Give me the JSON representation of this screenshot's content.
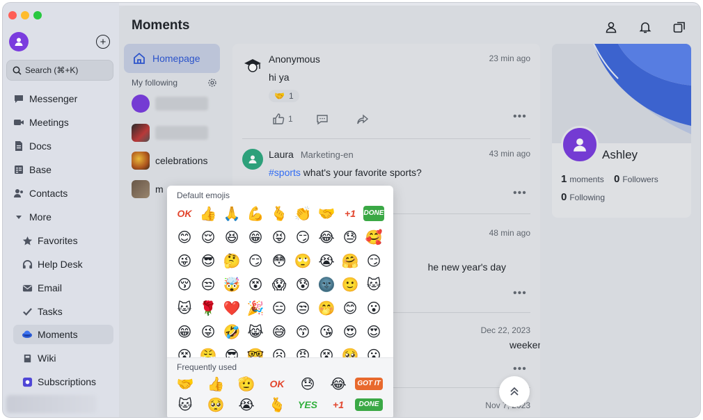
{
  "window": {
    "traffic_lights": {
      "close": "#ff5f57",
      "minimize": "#febc2e",
      "zoom": "#28c840"
    }
  },
  "sidebar": {
    "avatar_icon": "user-avatar-icon",
    "add_icon": "plus-circle-icon",
    "search_label": "Search (⌘+K)",
    "items": [
      {
        "label": "Messenger",
        "icon": "chat-bubble-icon"
      },
      {
        "label": "Meetings",
        "icon": "video-camera-icon"
      },
      {
        "label": "Docs",
        "icon": "docs-icon"
      },
      {
        "label": "Base",
        "icon": "table-icon"
      },
      {
        "label": "Contacts",
        "icon": "contacts-icon"
      },
      {
        "label": "More",
        "icon": "caret-down-icon"
      },
      {
        "label": "Favorites",
        "icon": "star-icon"
      },
      {
        "label": "Help Desk",
        "icon": "headset-icon"
      },
      {
        "label": "Email",
        "icon": "mail-icon"
      },
      {
        "label": "Tasks",
        "icon": "check-icon"
      },
      {
        "label": "Moments",
        "icon": "moments-planet-icon"
      },
      {
        "label": "Wiki",
        "icon": "wiki-icon"
      },
      {
        "label": "Subscriptions",
        "icon": "subscriptions-icon"
      }
    ],
    "active_item": "Moments"
  },
  "header": {
    "title": "Moments",
    "icons": [
      "profile-icon",
      "bell-icon",
      "window-switch-icon"
    ]
  },
  "feed_nav": {
    "homepage_label": "Homepage",
    "following_label": "My following",
    "following": [
      {
        "label": ""
      },
      {
        "label": ""
      },
      {
        "label": "celebrations"
      },
      {
        "label": "m"
      }
    ]
  },
  "posts": [
    {
      "author": "Anonymous",
      "time": "23 min ago",
      "body": "hi ya",
      "reaction": {
        "emoji": "🤝",
        "count": "1"
      },
      "like_count": "1"
    },
    {
      "author": "Laura",
      "group": "Marketing-en",
      "time": "43 min ago",
      "hashtag": "#sports",
      "body": " what's your favorite sports?"
    },
    {
      "time": "48 min ago",
      "body_fragment": "he new year's day"
    },
    {
      "time": "Dec 22, 2023",
      "body_fragment": "weekends?"
    },
    {
      "time": "Nov 7, 2023"
    }
  ],
  "emoji_picker": {
    "default_title": "Default emojis",
    "frequent_title": "Frequently used",
    "default_rows": [
      [
        "OK",
        "👍",
        "🙏",
        "💪",
        "🫰",
        "👏",
        "🤝",
        "+1",
        "DONE"
      ],
      [
        "😊",
        "😌",
        "😆",
        "😁",
        "😝",
        "😏",
        "😂",
        "😓",
        "🥰"
      ],
      [
        "😜",
        "😎",
        "🤔",
        "😏",
        "😳",
        "🙄",
        "😭",
        "🤗",
        "😏"
      ],
      [
        "😚",
        "😒",
        "🤯",
        "😵",
        "😱",
        "😰",
        "🌚",
        "🙂",
        "🐱"
      ],
      [
        "🐱",
        "🌹",
        "❤️",
        "🎉",
        "😑",
        "😒",
        "🤭",
        "😊",
        "😮"
      ],
      [
        "😁",
        "😜",
        "🤣",
        "😹",
        "😅",
        "😙",
        "😘",
        "😍",
        "😍"
      ],
      [
        "😵",
        "😤",
        "😎",
        "🤓",
        "😦",
        "😠",
        "😵",
        "🥺",
        "😮"
      ]
    ],
    "frequent_rows": [
      [
        "🤝",
        "👍",
        "🫡",
        "OK",
        "😓",
        "😂",
        "GOT IT"
      ],
      [
        "🐱",
        "🥺",
        "😭",
        "🫰",
        "YES",
        "+1",
        "DONE"
      ]
    ]
  },
  "profile": {
    "name": "Ashley",
    "moments_count": "1",
    "moments_label": "moments",
    "followers_count": "0",
    "followers_label": "Followers",
    "following_count": "0",
    "following_label": "Following"
  },
  "scroll_top_icon": "double-chevron-up-icon"
}
